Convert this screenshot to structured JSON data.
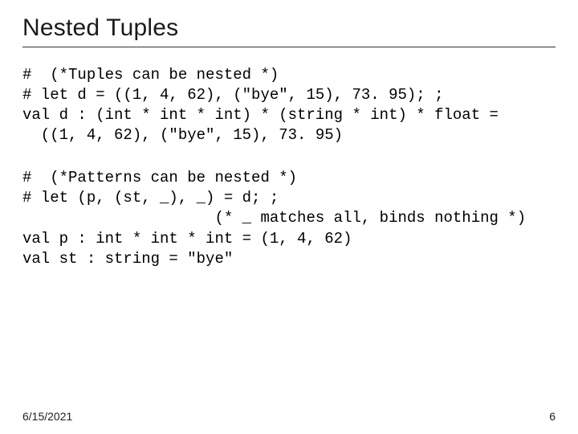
{
  "title": "Nested Tuples",
  "code1": "#  (*Tuples can be nested *)\n# let d = ((1, 4, 62), (\"bye\", 15), 73. 95); ;\nval d : (int * int * int) * (string * int) * float =\n  ((1, 4, 62), (\"bye\", 15), 73. 95)",
  "code2": "#  (*Patterns can be nested *)\n# let (p, (st, _), _) = d; ;\n                     (* _ matches all, binds nothing *)\nval p : int * int * int = (1, 4, 62)\nval st : string = \"bye\"",
  "footer": {
    "date": "6/15/2021",
    "page": "6"
  }
}
